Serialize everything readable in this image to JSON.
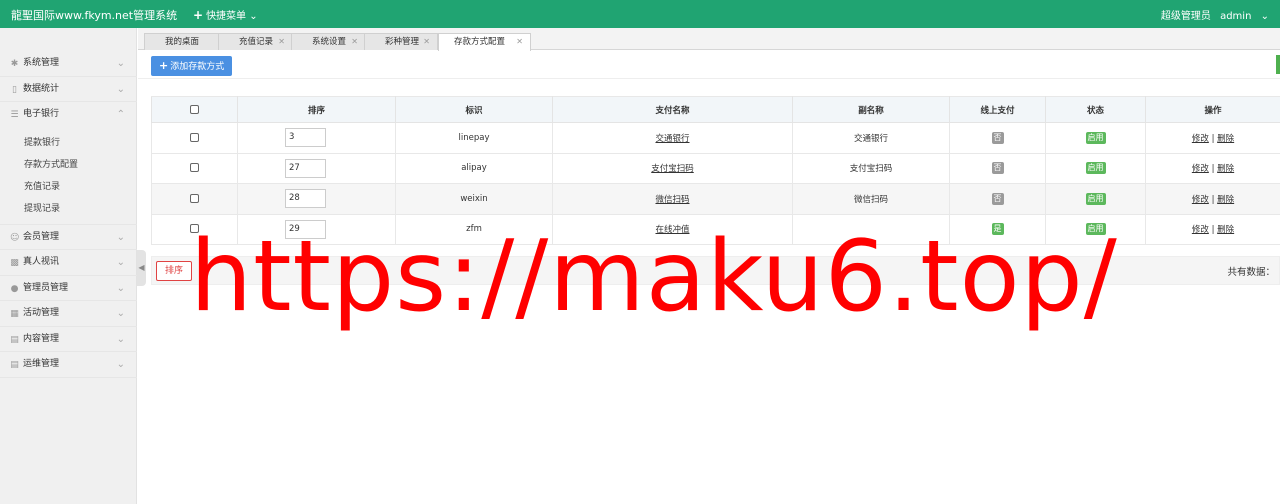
{
  "header": {
    "brand": "龍聖国际www.fkym.net管理系统",
    "quick_menu": "快捷菜单",
    "role": "超级管理员",
    "username": "admin"
  },
  "sidebar": {
    "items": [
      {
        "label": "系统管理",
        "icon": "gear-icon"
      },
      {
        "label": "数据统计",
        "icon": "bar-chart-icon"
      },
      {
        "label": "电子银行",
        "icon": "list-icon",
        "expanded": true,
        "children": [
          "提款银行",
          "存款方式配置",
          "充值记录",
          "提现记录"
        ]
      },
      {
        "label": "会员管理",
        "icon": "user-icon"
      },
      {
        "label": "真人视讯",
        "icon": "video-icon"
      },
      {
        "label": "管理员管理",
        "icon": "admin-icon"
      },
      {
        "label": "活动管理",
        "icon": "calendar-icon"
      },
      {
        "label": "内容管理",
        "icon": "content-icon"
      },
      {
        "label": "运维管理",
        "icon": "server-icon"
      }
    ]
  },
  "tabs": [
    {
      "label": "我的桌面",
      "closable": false
    },
    {
      "label": "充值记录",
      "closable": true
    },
    {
      "label": "系统设置",
      "closable": true
    },
    {
      "label": "彩种管理",
      "closable": true
    },
    {
      "label": "存款方式配置",
      "closable": true,
      "active": true
    }
  ],
  "toolbar": {
    "add_label": "添加存款方式"
  },
  "table": {
    "headers": [
      "",
      "排序",
      "标识",
      "支付名称",
      "副名称",
      "线上支付",
      "状态",
      "操作"
    ],
    "rows": [
      {
        "sort": "3",
        "code": "linepay",
        "name": "交通银行",
        "alias": "交通银行",
        "online": "否",
        "status": "启用"
      },
      {
        "sort": "27",
        "code": "alipay",
        "name": "支付宝扫码",
        "alias": "支付宝扫码",
        "online": "否",
        "status": "启用"
      },
      {
        "sort": "28",
        "code": "weixin",
        "name": "微信扫码",
        "alias": "微信扫码",
        "online": "否",
        "status": "启用"
      },
      {
        "sort": "29",
        "code": "zfm",
        "name": "在线冲值",
        "alias": "",
        "online": "是",
        "status": "启用"
      }
    ],
    "edit_label": "修改",
    "separator": "|",
    "delete_label": "删除"
  },
  "footer": {
    "sort_button": "排序",
    "total_label": "共有数据："
  },
  "watermark": "https://maku6.top/",
  "colors": {
    "topbar": "#20a472",
    "primary_button": "#4a90e2",
    "enabled_tag": "#5cb85c",
    "disabled_tag": "#9a9a9a",
    "danger": "#e04343",
    "watermark": "#ff0000"
  }
}
